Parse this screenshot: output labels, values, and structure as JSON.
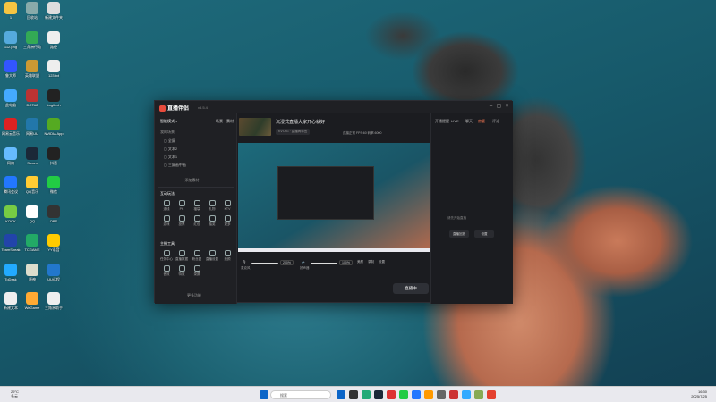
{
  "app": {
    "name": "直播伴侣",
    "version": "v5.5.4",
    "stream_title": "沉浸式直播大家开心就好",
    "stream_tags": "KVTAG  · 直播间标签",
    "live_button": "直播中",
    "status": [
      "连接正常",
      "FPS:60",
      "码率:6000"
    ],
    "sidebar": {
      "section_header": "智能模式",
      "tabs": [
        "场景",
        "素材"
      ],
      "scene_label": "我的场景",
      "scene_items": [
        "全屏",
        "文本2",
        "文本1",
        "三屏画中画"
      ],
      "add_source": "+ 添加素材",
      "interact_header": "互动玩法",
      "interact_tools": [
        "连线",
        "PK",
        "福袋",
        "礼物",
        "KTV",
        "游戏",
        "投票",
        "红包",
        "抽奖",
        "更多"
      ],
      "tools_header": "主播工具",
      "anchor_tools": [
        "任务中心",
        "直播数据",
        "粉丝团",
        "直播设置",
        "美颜",
        "音效",
        "特效",
        "录屏"
      ],
      "more_label": "更多功能"
    },
    "controls": {
      "mic_label": "麦克风",
      "mic_pct": "200%",
      "speaker_label": "扬声器",
      "speaker_pct": "100%",
      "icons": [
        "美颜",
        "录制",
        "设置"
      ]
    },
    "right_panel": {
      "tabs": [
        "开播提醒",
        "LIVE",
        "聊天",
        "房管",
        "评论"
      ],
      "hint": "请先开始直播",
      "buttons": [
        "直播回放",
        "设置"
      ]
    }
  },
  "desktop_icons": [
    {
      "label": "1",
      "color": "#f5c542"
    },
    {
      "label": "回收站",
      "color": "#8aa"
    },
    {
      "label": "新建文件夹",
      "color": "#ddd"
    },
    {
      "label": "112.png",
      "color": "#5ad"
    },
    {
      "label": "三角洲行动",
      "color": "#3a5"
    },
    {
      "label": "路径",
      "color": "#eee"
    },
    {
      "label": "鲁大师",
      "color": "#35f"
    },
    {
      "label": "英雄联盟",
      "color": "#c93"
    },
    {
      "label": "123.txt",
      "color": "#eee"
    },
    {
      "label": "此电脑",
      "color": "#4af"
    },
    {
      "label": "DOTA2",
      "color": "#b33"
    },
    {
      "label": "Logitech",
      "color": "#222"
    },
    {
      "label": "网易云音乐",
      "color": "#d22"
    },
    {
      "label": "网易UU",
      "color": "#27a"
    },
    {
      "label": "NVIDIA App",
      "color": "#5a2"
    },
    {
      "label": "网络",
      "color": "#6bf"
    },
    {
      "label": "Steam",
      "color": "#1b2838"
    },
    {
      "label": "抖音",
      "color": "#222"
    },
    {
      "label": "腾讯会议",
      "color": "#27f"
    },
    {
      "label": "QQ音乐",
      "color": "#fc3"
    },
    {
      "label": "微信",
      "color": "#2c4"
    },
    {
      "label": "KOOK",
      "color": "#7c4"
    },
    {
      "label": "QQ",
      "color": "#fff"
    },
    {
      "label": "OBS",
      "color": "#333"
    },
    {
      "label": "TeamSpeak",
      "color": "#24a"
    },
    {
      "label": "TCGAME",
      "color": "#2a6"
    },
    {
      "label": "YY语音",
      "color": "#fc0"
    },
    {
      "label": "ToDesk",
      "color": "#2af"
    },
    {
      "label": "原神",
      "color": "#ddc"
    },
    {
      "label": "UU远程",
      "color": "#27c"
    },
    {
      "label": "新建文本",
      "color": "#eee"
    },
    {
      "label": "WeGame",
      "color": "#fa3"
    },
    {
      "label": "三角洲助手",
      "color": "#eee"
    }
  ],
  "taskbar": {
    "search_placeholder": "搜索",
    "weather": "29°C",
    "weather_desc": "多云",
    "time": "16:30",
    "date": "2025/7/25",
    "app_colors": [
      "#0a64c8",
      "#333",
      "#2a7",
      "#1b2838",
      "#d33",
      "#2c4",
      "#27f",
      "#f90",
      "#666",
      "#c33",
      "#3af",
      "#8a5",
      "#e4402e"
    ]
  }
}
